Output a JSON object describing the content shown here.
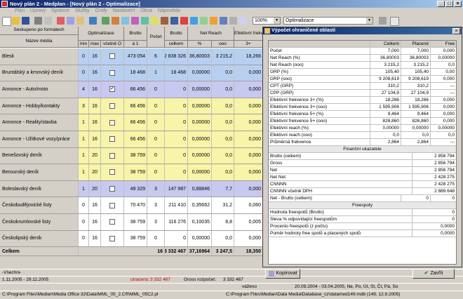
{
  "window": {
    "title": "Nový plán 2 - Medplan - [Nový plán 2 - Optimalizace]"
  },
  "menu": [
    "Plán",
    "Úpravy",
    "Správce",
    "Služby",
    "Grafy",
    "Nastavení",
    "Okna",
    "Nápověda"
  ],
  "toolbar": {
    "zoom": "100%",
    "mode": "Optimalizace"
  },
  "grid": {
    "group_label": "Seskupeno po formátech",
    "headers": {
      "name": "Název média",
      "optim": "Optimalizace",
      "min": "min",
      "max": "max",
      "incl": "včetně O",
      "brutto": "Brutto",
      "brutto_sub": "á 1",
      "pocet": "Počet",
      "brutto2": "Brutto",
      "brutto2_sub": "celkem",
      "netreach": "Net Reach",
      "pct": "%",
      "ooo": "ooo",
      "eff": "Efektivní frekv",
      "eff_sub": "3+"
    },
    "rows": [
      {
        "name": "Blesk",
        "min": "0",
        "max": "16",
        "checked": false,
        "brutto": "473 054",
        "pocet": "6",
        "brutto_c": "2 838 326",
        "pct": "36,80003",
        "ooo": "3 215,2",
        "eff": "18,266",
        "color": "#b8d0f0"
      },
      {
        "name": "Bruntálský a krnovský deník",
        "min": "0",
        "max": "16",
        "checked": false,
        "brutto": "18 468",
        "pocet": "1",
        "brutto_c": "18 468",
        "pct": "0,00000",
        "ooo": "0,0",
        "eff": "0,000",
        "color": "#b8d0f0"
      },
      {
        "name": "Annonce - Auto/moto",
        "min": "4",
        "max": "16",
        "checked": true,
        "brutto": "66 456",
        "pocet": "0",
        "brutto_c": "0",
        "pct": "0,00000",
        "ooo": "0,0",
        "eff": "0,000",
        "color": "#c8c8f0"
      },
      {
        "name": "Annonce - Hobby/kontakty",
        "min": "3",
        "max": "16",
        "checked": false,
        "brutto": "66 456",
        "pocet": "0",
        "brutto_c": "0",
        "pct": "0,00000",
        "ooo": "0,0",
        "eff": "0,000",
        "color": "#f8f4a8"
      },
      {
        "name": "Annonce - Reality/stavba",
        "min": "1",
        "max": "16",
        "checked": false,
        "brutto": "66 456",
        "pocet": "0",
        "brutto_c": "0",
        "pct": "0,00000",
        "ooo": "0,0",
        "eff": "0,000",
        "color": "#f8f4a8"
      },
      {
        "name": "Annonce - Užitkové vozy/práce",
        "min": "1",
        "max": "16",
        "checked": false,
        "brutto": "66 456",
        "pocet": "0",
        "brutto_c": "0",
        "pct": "0,00000",
        "ooo": "0,0",
        "eff": "0,000",
        "color": "#f8f4a8"
      },
      {
        "name": "Benešovský deník",
        "min": "1",
        "max": "20",
        "checked": false,
        "brutto": "38 759",
        "pocet": "0",
        "brutto_c": "0",
        "pct": "0,00000",
        "ooo": "0,0",
        "eff": "0,000",
        "color": "#f8f4a8"
      },
      {
        "name": "Berounský deník",
        "min": "1",
        "max": "20",
        "checked": false,
        "brutto": "38 759",
        "pocet": "0",
        "brutto_c": "0",
        "pct": "0,00000",
        "ooo": "0,0",
        "eff": "0,000",
        "color": "#f8f4a8"
      },
      {
        "name": "Boleslavský deník",
        "min": "1",
        "max": "20",
        "checked": false,
        "brutto": "49 329",
        "pocet": "3",
        "brutto_c": "147 987",
        "pct": "0,88846",
        "ooo": "7,7",
        "eff": "0,000",
        "color": "#c8c8f0"
      },
      {
        "name": "Českobudějovické listy",
        "min": "0",
        "max": "16",
        "checked": false,
        "brutto": "70 470",
        "pocet": "3",
        "brutto_c": "211 410",
        "pct": "0,35662",
        "ooo": "31,2",
        "eff": "0,060",
        "color": "#ffffff"
      },
      {
        "name": "Českokrumlovské listy",
        "min": "0",
        "max": "16",
        "checked": false,
        "brutto": "38 759",
        "pocet": "3",
        "brutto_c": "116 276",
        "pct": "0,10035",
        "ooo": "8,8",
        "eff": "0,005",
        "color": "#ffffff"
      },
      {
        "name": "Českolipský deník",
        "min": "0",
        "max": "16",
        "checked": false,
        "brutto": "38 759",
        "pocet": "0",
        "brutto_c": "0",
        "pct": "0,00000",
        "ooo": "0,0",
        "eff": "0,000",
        "color": "#ffffff"
      }
    ],
    "total": {
      "label": "Celkem",
      "pocet": "16",
      "brutto_c": "3 332 467",
      "pct": "37,16964",
      "ooo": "3 247,5",
      "eff": "18,350"
    }
  },
  "status": {
    "filter": "-Všechni-",
    "dates": "1.11.2005 - 29.11.2005",
    "utraceno_label": "utraceno:",
    "utraceno_value": "3 332 467",
    "gross_label": "Gross rozpočet:",
    "gross_value": "3 332 467",
    "vazeno": "váženo",
    "period": "20.09.2004 - 03.04.2005, Ne, Po, Út, St, Čt, Pá, So",
    "path_left": "C:\\Program Files\\Median\\Media Office 32\\Data\\MML_05_2.CR\\MML_05C2.pl",
    "path_right": "C:\\Program Files\\Median\\Data Media\\Database_cz\\datamed149.mdb (149, 12.9.2005)"
  },
  "dialog": {
    "title": "Výpočet ohraničené oblasti",
    "col_celkem": "Celkem",
    "col_placene": "Placené",
    "col_free": "Free",
    "rows": [
      [
        "Počet",
        "7,000",
        "7,000",
        "0,000"
      ],
      [
        "Net Reach (%)",
        "36,80003",
        "36,80003",
        "0,00000"
      ],
      [
        "Net Reach (ooo)",
        "3 215,2",
        "3 215,2",
        "0,0"
      ],
      [
        "GRP (%)",
        "105,40",
        "105,40",
        "0,00"
      ],
      [
        "GRP (ooo)",
        "9 208,619",
        "9 208,619",
        "0,000"
      ],
      [
        "CPT (GRP)",
        "310,2",
        "310,2",
        "---"
      ],
      [
        "CPP (GRP)",
        "27 104,9",
        "27 104,9",
        "---"
      ],
      [
        "Efektivní frekvence 3+ (%)",
        "18,266",
        "18,266",
        "0,000"
      ],
      [
        "Efektivní frekvence 3+ (ooo)",
        "1 595,906",
        "1 595,906",
        "0,000"
      ],
      [
        "Efektivní frekvence 5+ (%)",
        "9,464",
        "9,464",
        "0,000"
      ],
      [
        "Efektivní frekvence 5+ (ooo)",
        "826,860",
        "826,860",
        "0,000"
      ],
      [
        "Efektivní reach (%)",
        "0,00000",
        "0,00000",
        "0,00000"
      ],
      [
        "Efektivní reach (ooo)",
        "0,0",
        "0,0",
        "0,0"
      ],
      [
        "Průměrná frekvence",
        "2,864",
        "2,864",
        "---"
      ]
    ],
    "fin_section": "Finanční ukazatele",
    "fin_rows": [
      [
        "Brutto (celkem)",
        "2 856 794"
      ],
      [
        "Gross",
        "2 856 794"
      ],
      [
        "Net",
        "2 856 794"
      ],
      [
        "Net Net",
        "2 428 275"
      ],
      [
        "CNNNN",
        "2 428 275"
      ],
      [
        "CNNNN včetně DPH",
        "2 889 648"
      ],
      [
        "Net - Brutto (celkem)",
        "0",
        "0"
      ]
    ],
    "free_section": "Freespoty",
    "free_rows": [
      [
        "Hodnota freespotů (Brutto)",
        "0"
      ],
      [
        "Sleva % odpovídající freespotům",
        "0"
      ],
      [
        "Procento freespotů (z počtu)",
        "0,0000"
      ],
      [
        "Poměr hodnoty free spotů a placených spotů",
        "0,0000"
      ]
    ],
    "copy_label": "Kopírovat",
    "close_label": "Zavřít"
  }
}
